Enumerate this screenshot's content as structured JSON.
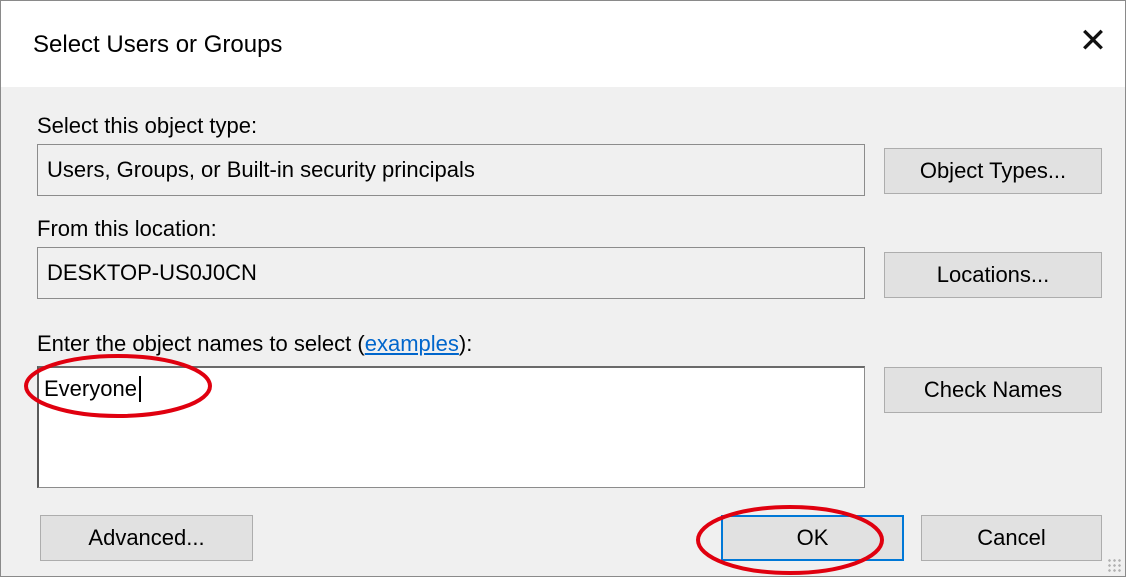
{
  "window": {
    "title": "Select Users or Groups"
  },
  "object_type": {
    "label": "Select this object type:",
    "value": "Users, Groups, or Built-in security principals",
    "button": "Object Types..."
  },
  "location": {
    "label": "From this location:",
    "value": "DESKTOP-US0J0CN",
    "button": "Locations..."
  },
  "names": {
    "label_prefix": "Enter the object names to select (",
    "link": "examples",
    "label_suffix": "):",
    "value": "Everyone",
    "check_button": "Check Names"
  },
  "footer": {
    "advanced_button": "Advanced...",
    "ok_button": "OK",
    "cancel_button": "Cancel"
  },
  "annotations": {
    "color": "#e0000f"
  },
  "icons": {
    "close": "close-icon",
    "resize": "resize-grip-icon"
  }
}
